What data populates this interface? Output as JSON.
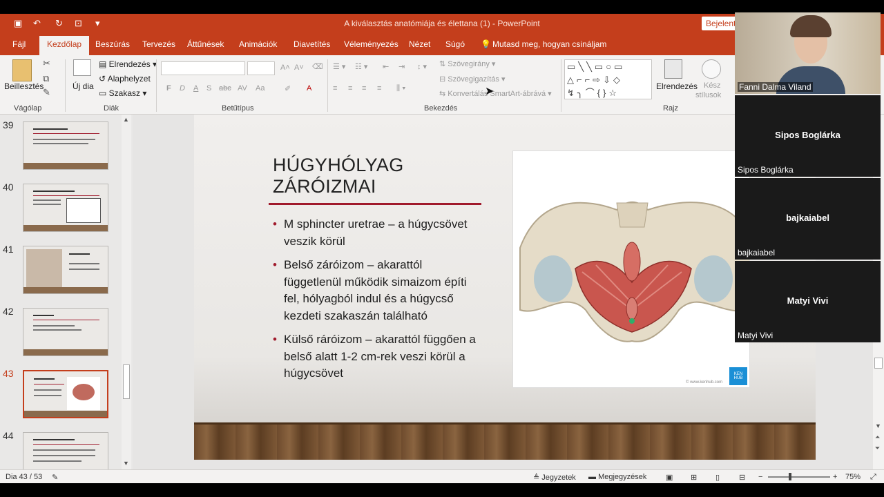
{
  "app": {
    "doc_title": "A kiválasztás anatómiája és élettana (1)  -  PowerPoint",
    "signin": "Bejelentk"
  },
  "tabs": [
    "Fájl",
    "Kezdőlap",
    "Beszúrás",
    "Tervezés",
    "Áttűnések",
    "Animációk",
    "Diavetítés",
    "Véleményezés",
    "Nézet",
    "Súgó"
  ],
  "tellme": "Mutasd meg, hogyan csináljam",
  "ribbon": {
    "paste": "Beillesztés",
    "new_slide": "Új dia",
    "layout": "Elrendezés",
    "reset": "Alaphelyzet",
    "section": "Szakasz",
    "text_direction": "Szövegirány",
    "align_text": "Szövegigazítás",
    "convert_smartart": "Konvertálás SmartArt-ábrává",
    "arrange": "Elrendezés",
    "quick_styles_1": "Kész",
    "quick_styles_2": "stílusok",
    "groups": {
      "clipboard": "Vágólap",
      "slides": "Diák",
      "font": "Betűtípus",
      "paragraph": "Bekezdés",
      "drawing": "Rajz"
    },
    "font_buttons": [
      "F",
      "D",
      "A",
      "S",
      "abc",
      "AV",
      "Aa",
      "A"
    ]
  },
  "thumbnails": [
    {
      "num": "39",
      "title": "VESEKÖRI ÉS ALVÁSZELEMEK"
    },
    {
      "num": "40",
      "title": "KISELÉS SZERVEK — A HÚGYVEZETÉK"
    },
    {
      "num": "41",
      "title": "HÚGYHÓLYAG SEGÉD"
    },
    {
      "num": "42",
      "title": "HÚGYVEZÉS"
    },
    {
      "num": "43",
      "title": "HÚGYHÓLYAG ZÁRÓIZMAI"
    },
    {
      "num": "44",
      "title": "KISELÉS SZERVEK — A HÚGYCSŐ"
    }
  ],
  "slide": {
    "title": "HÚGYHÓLYAG ZÁRÓIZMAI",
    "bullets": [
      "M sphincter uretrae – a húgycsövet veszik körül",
      "Belső záróizom – akarattól függetlenül működik simaizom építi fel,  hólyagból indul és a húgycső kezdeti szakaszán található",
      "Külső ráróizom – akarattól függően a belső alatt 1-2 cm-rek veszi körül a húgycsövet"
    ],
    "image_logo": "KEN HUB",
    "image_watermark": "© www.kenhub.com"
  },
  "status": {
    "slide_counter": "Dia 43 / 53",
    "notes": "Jegyzetek",
    "comments": "Megjegyzések",
    "zoom": "75%"
  },
  "participants": [
    {
      "name": "Fanni Dalma Viland",
      "video": true
    },
    {
      "name": "Sipos Boglárka",
      "video": false
    },
    {
      "name": "bajkaiabel",
      "video": false
    },
    {
      "name": "Matyi Vivi",
      "video": false
    }
  ],
  "colors": {
    "accent": "#c43e1c",
    "title_rule": "#a01a2c",
    "logo": "#1a8fd6"
  }
}
